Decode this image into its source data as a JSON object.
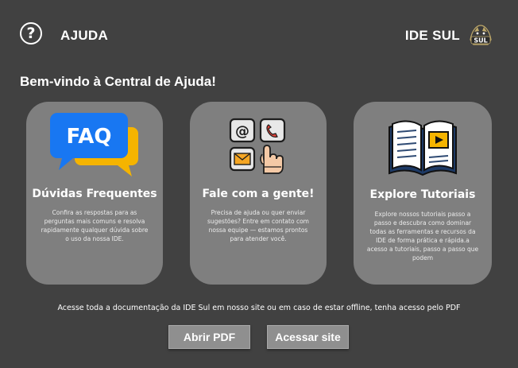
{
  "header": {
    "help_icon": "question-mark-circle-icon",
    "help_glyph": "?",
    "title": "AJUDA",
    "brand_name": "IDE SUL",
    "brand_logo_text": "SUL"
  },
  "welcome": "Bem-vindo à Central de Ajuda!",
  "cards": [
    {
      "icon": "faq-speech-bubbles-icon",
      "icon_text": "FAQ",
      "title": "Dúvidas Frequentes",
      "description": "Confira as respostas para as perguntas mais comuns e resolva rapidamente qualquer dúvida sobre o uso da nossa IDE."
    },
    {
      "icon": "contact-touch-icon",
      "title": "Fale com a gente!",
      "description": "Precisa de ajuda ou quer enviar sugestões? Entre em contato com nossa equipe — estamos prontos para atender você."
    },
    {
      "icon": "open-book-video-icon",
      "title": "Explore Tutoriais",
      "description": "Explore nossos tutoriais passo a passo e descubra como dominar todas as ferramentas e recursos da IDE de forma prática e rápida.a acesso a tutoriais, passo a passo que podem"
    }
  ],
  "documentation_text": "Acesse toda a documentação da IDE Sul em nosso site ou em caso de estar offline, tenha acesso pelo PDF",
  "buttons": {
    "open_pdf": "Abrir PDF",
    "visit_site": "Acessar site"
  },
  "colors": {
    "background": "#414141",
    "card": "#7f7f7f",
    "button": "#8f8f8f",
    "faq_blue": "#1877f2",
    "faq_yellow": "#f5b400"
  }
}
